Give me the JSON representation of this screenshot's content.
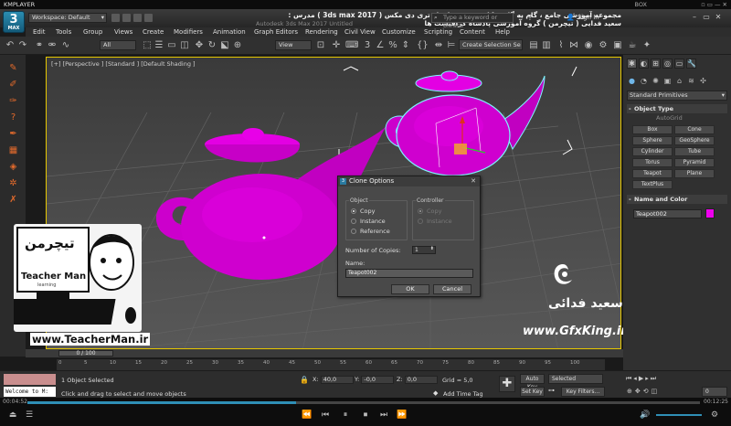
{
  "player": {
    "brand": "KMPLAYER",
    "right_label": "BOX",
    "current_time": "00:04:52",
    "total_time": "00:12:25",
    "progress": 0.4
  },
  "max_logo": {
    "number": "3",
    "label": "MAX"
  },
  "workspace": "Workspace: Default",
  "course_title": "مجموعه آموزشی جامع ، گام به گام و کاربردی نرم افزار تری دی مکس ( 3ds max 2017 )   مدرس : سعید فدایی ( تیچرمن ) گروه آموزشی پادشاه گرافیست ها",
  "app_title": "Autodesk 3ds Max 2017    Untitled",
  "search_placeholder": "Type a keyword or phrase",
  "sign_in": "Sign In",
  "menu": [
    "Edit",
    "Tools",
    "Group",
    "Views",
    "Create",
    "Modifiers",
    "Animation",
    "Graph Editors",
    "Rendering",
    "Civil View",
    "Customize",
    "Scripting",
    "Content",
    "Help"
  ],
  "toolbar": {
    "filter": "All",
    "ref_coord": "View",
    "selection_set": "Create Selection Se"
  },
  "viewport": {
    "label": "[+] [Perspective ] [Standard ] [Default Shading ]"
  },
  "cmd_panel": {
    "category": "Standard Primitives",
    "object_type_header": "Object Type",
    "autogrid": "AutoGrid",
    "objects": [
      "Box",
      "Cone",
      "Sphere",
      "GeoSphere",
      "Cylinder",
      "Tube",
      "Torus",
      "Pyramid",
      "Teapot",
      "Plane",
      "TextPlus"
    ],
    "name_color_header": "Name and Color",
    "name_value": "Teapot002",
    "color": "#ee00ee"
  },
  "dialog": {
    "title": "Clone Options",
    "object_group": "Object",
    "controller_group": "Controller",
    "object_options": [
      {
        "label": "Copy",
        "selected": true
      },
      {
        "label": "Instance",
        "selected": false
      },
      {
        "label": "Reference",
        "selected": false
      }
    ],
    "controller_options": [
      {
        "label": "Copy",
        "selected": true
      },
      {
        "label": "Instance",
        "selected": false
      }
    ],
    "copies_label": "Number of Copies:",
    "copies_value": "1",
    "name_label": "Name:",
    "name_value": "Teapot002",
    "ok": "OK",
    "cancel": "Cancel"
  },
  "watermark": {
    "teacher_fa": "تیچرمن",
    "teacher_en": "Teacher Man",
    "learning": "learning",
    "url": "www.TeacherMan.ir",
    "gfx_fa": "سعید فدائی",
    "gfx_url": "www.GfxKing.ir"
  },
  "timeline": {
    "slider": "0 / 100",
    "ticks": [
      "0",
      "5",
      "10",
      "15",
      "20",
      "25",
      "30",
      "35",
      "40",
      "45",
      "50",
      "55",
      "60",
      "65",
      "70",
      "75",
      "80",
      "85",
      "90",
      "95",
      "100"
    ]
  },
  "status": {
    "selected": "1 Object Selected",
    "prompt": "Click and drag to select and move objects",
    "x": "40,0",
    "y": "-0,0",
    "z": "0,0",
    "grid": "Grid = 5,0",
    "add_time_tag": "Add Time Tag",
    "auto_key": "Auto Key",
    "set_key": "Set Key",
    "selected_dd": "Selected",
    "key_filters": "Key Filters...",
    "frame": "0",
    "welcome": "Welcome to M:"
  }
}
